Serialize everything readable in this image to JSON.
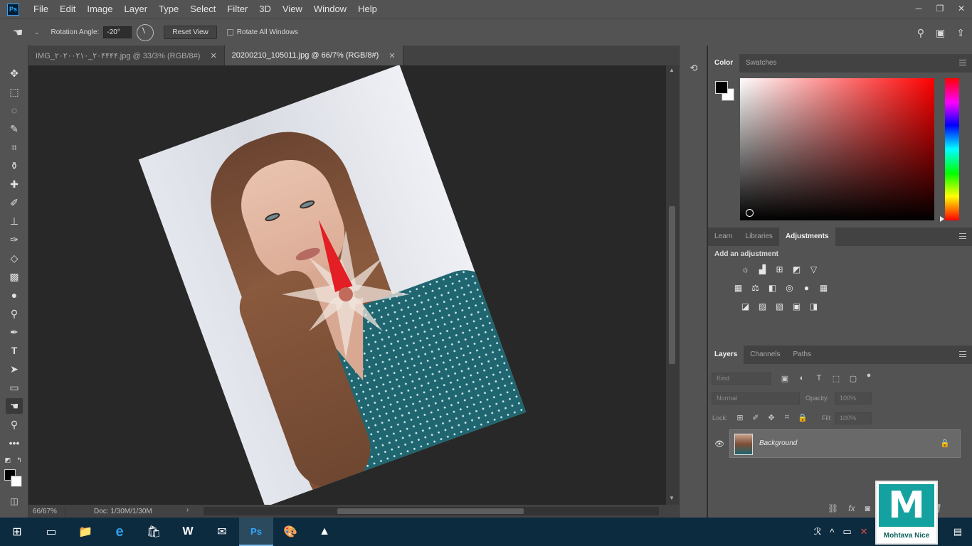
{
  "menubar": {
    "logo": "Ps",
    "items": [
      "File",
      "Edit",
      "Image",
      "Layer",
      "Type",
      "Select",
      "Filter",
      "3D",
      "View",
      "Window",
      "Help"
    ],
    "window_controls": [
      "─",
      "❐",
      "✕"
    ]
  },
  "options": {
    "rotation_label": "Rotation Angle:",
    "rotation_value": "-20°",
    "reset_view_label": "Reset View",
    "rotate_all_label": "Rotate All Windows"
  },
  "documents": {
    "tabs": [
      {
        "label": "IMG_۲۰۲۰۰۲۱۰_۲۰۴۴۴۴.jpg @ 33/3% (RGB/8#)",
        "active": false
      },
      {
        "label": "20200210_105011.jpg @ 66/7% (RGB/8#)",
        "active": true
      }
    ],
    "close_glyph": "✕"
  },
  "status": {
    "zoom": "66/67%",
    "doc_info": "Doc: 1/30M/1/30M"
  },
  "color_panel": {
    "tabs": [
      "Color",
      "Swatches"
    ],
    "foreground": "#000000",
    "background": "#ffffff",
    "hue_color": "#ff0000"
  },
  "adjust_panel": {
    "tabs": [
      "Learn",
      "Libraries",
      "Adjustments"
    ],
    "title": "Add an adjustment",
    "rows": [
      [
        "☼",
        "▟",
        "⊞",
        "◩",
        "▽"
      ],
      [
        "▦",
        "⚖",
        "◧",
        "◎",
        "●",
        "▦"
      ],
      [
        "◪",
        "▨",
        "▧",
        "▣",
        "◨"
      ]
    ]
  },
  "layers_panel": {
    "tabs": [
      "Layers",
      "Channels",
      "Paths"
    ],
    "kind_placeholder": "Kind",
    "blend_mode": "Normal",
    "opacity_label": "Opacity:",
    "opacity_value": "100%",
    "lock_label": "Lock:",
    "fill_label": "Fill:",
    "fill_value": "100%",
    "layer_name": "Background",
    "footer_icons": [
      "⛓",
      "fx",
      "◙",
      "◐",
      "▭",
      "▢",
      "🗑"
    ]
  },
  "logo": {
    "mark": "M",
    "text": "Mohtava Nice",
    "brand_color": "#14a2a0"
  },
  "taskbar": {
    "icons": [
      "⊞",
      "▭",
      "📁",
      "e",
      "🛍",
      "W",
      "✉",
      "Ps",
      "🎨",
      "▲"
    ],
    "tray": [
      "ℛ",
      "^",
      "▭",
      "✕",
      "🔊",
      "▤"
    ]
  }
}
